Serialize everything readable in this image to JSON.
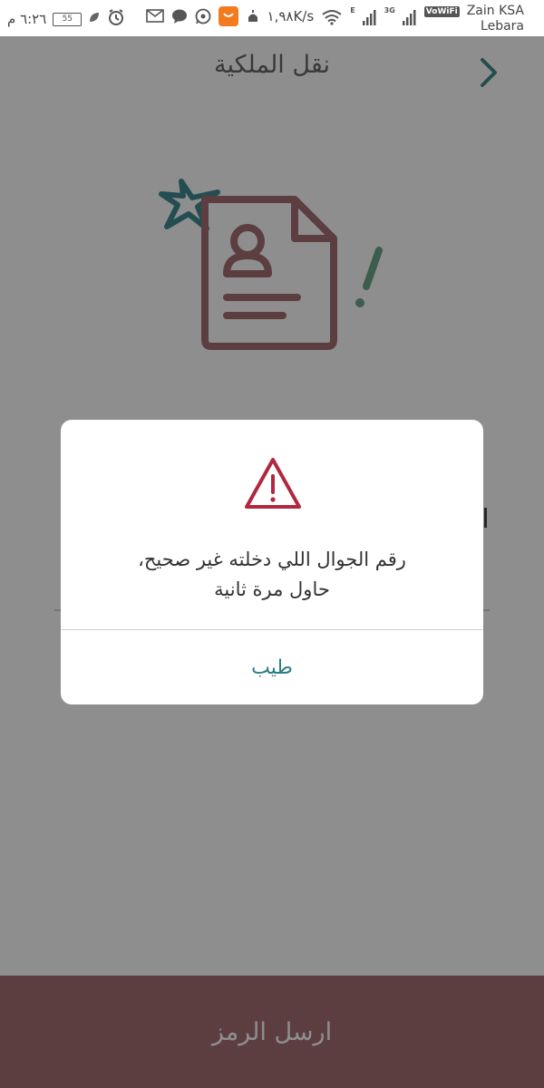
{
  "status_bar": {
    "time": "٦:٢٦ م",
    "battery_level": "55",
    "net_speed": "١,٩٨K/s",
    "network_e": "E",
    "network_3g": "3G",
    "vowifi_label": "VoWiFi",
    "carrier_1": "Zain KSA",
    "carrier_2": "Lebara",
    "icons": [
      "alarm-icon",
      "leaf-icon",
      "mail-icon",
      "chat-icon",
      "whatsapp-icon",
      "shopping-app-icon",
      "mosque-icon",
      "wifi-icon",
      "signal-icon"
    ]
  },
  "screen": {
    "title": "نقل الملكية",
    "send_code_label": "ارسل الرمز"
  },
  "dialog": {
    "message_line1": "رقم الجوال اللي دخلته غير صحيح،",
    "message_line2": "حاول مرة ثانية",
    "ok_label": "طيب"
  },
  "colors": {
    "primary_maroon": "#9a5e64",
    "accent_teal": "#2a7d85",
    "warning_red": "#b0283e",
    "scrim": "rgba(30,30,30,0.5)"
  }
}
